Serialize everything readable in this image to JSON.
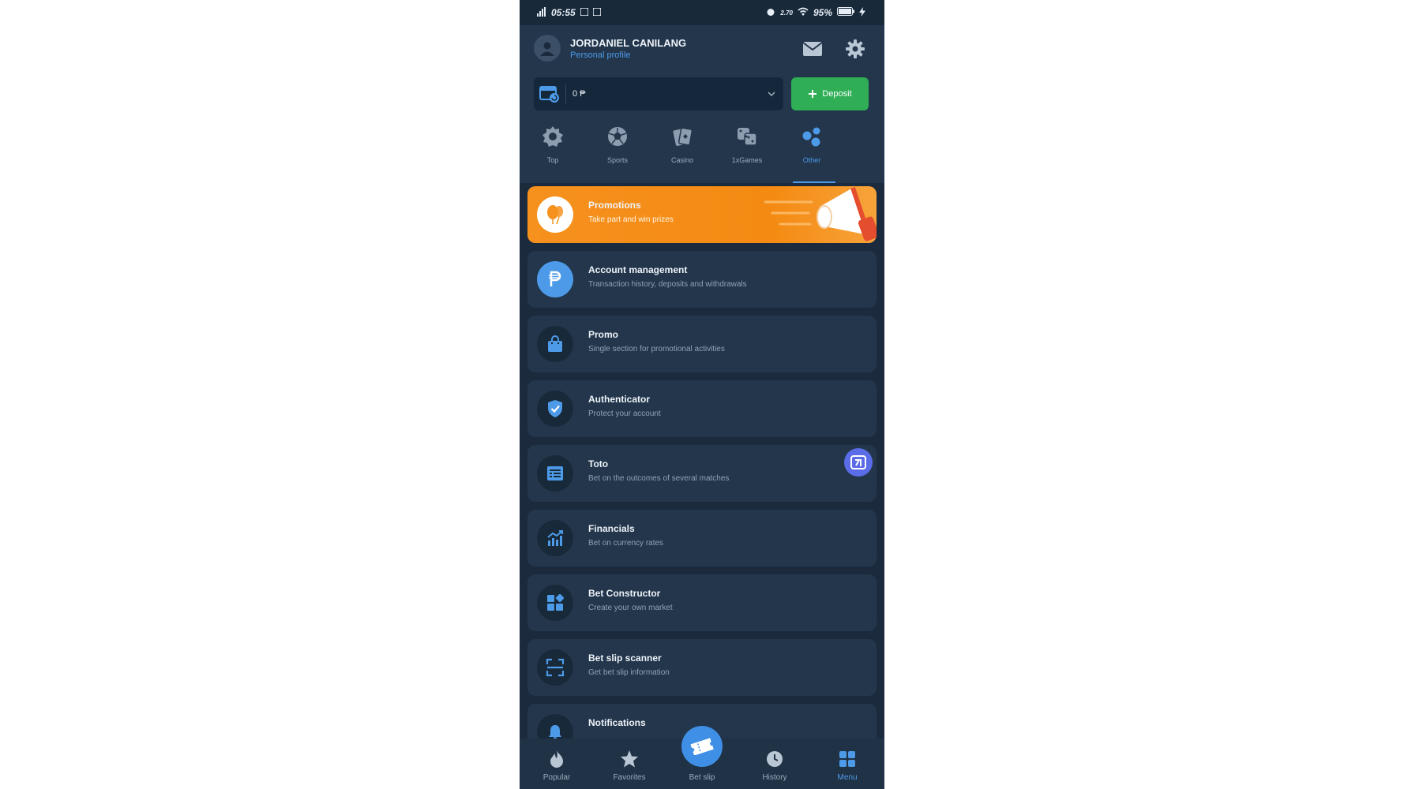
{
  "status": {
    "time": "05:55",
    "net_speed": "2.70",
    "battery": "95%"
  },
  "profile": {
    "name": "JORDANIEL CANILANG",
    "link": "Personal profile"
  },
  "wallet": {
    "amount": "0 ₱",
    "deposit_label": "Deposit"
  },
  "categories": [
    {
      "label": "Top",
      "icon": "gear-badge-icon"
    },
    {
      "label": "Sports",
      "icon": "soccer-ball-icon"
    },
    {
      "label": "Casino",
      "icon": "cards-icon"
    },
    {
      "label": "1xGames",
      "icon": "dice-icon"
    },
    {
      "label": "Other",
      "icon": "dots-icon",
      "active": true
    }
  ],
  "menu": [
    {
      "title": "Promotions",
      "subtitle": "Take part and win prizes"
    },
    {
      "title": "Account management",
      "subtitle": "Transaction history, deposits and withdrawals"
    },
    {
      "title": "Promo",
      "subtitle": "Single section for promotional activities"
    },
    {
      "title": "Authenticator",
      "subtitle": "Protect your account"
    },
    {
      "title": "Toto",
      "subtitle": "Bet on the outcomes of several matches"
    },
    {
      "title": "Financials",
      "subtitle": "Bet on currency rates"
    },
    {
      "title": "Bet Constructor",
      "subtitle": "Create your own market"
    },
    {
      "title": "Bet slip scanner",
      "subtitle": "Get bet slip information"
    },
    {
      "title": "Notifications",
      "subtitle": ""
    }
  ],
  "bottom_nav": [
    {
      "label": "Popular"
    },
    {
      "label": "Favorites"
    },
    {
      "label": "Bet slip"
    },
    {
      "label": "History"
    },
    {
      "label": "Menu",
      "active": true
    }
  ],
  "colors": {
    "accent": "#4d9be8",
    "deposit": "#2fae56",
    "promo": "#f6911e",
    "bg": "#1b2b3d",
    "card": "#23364c"
  }
}
